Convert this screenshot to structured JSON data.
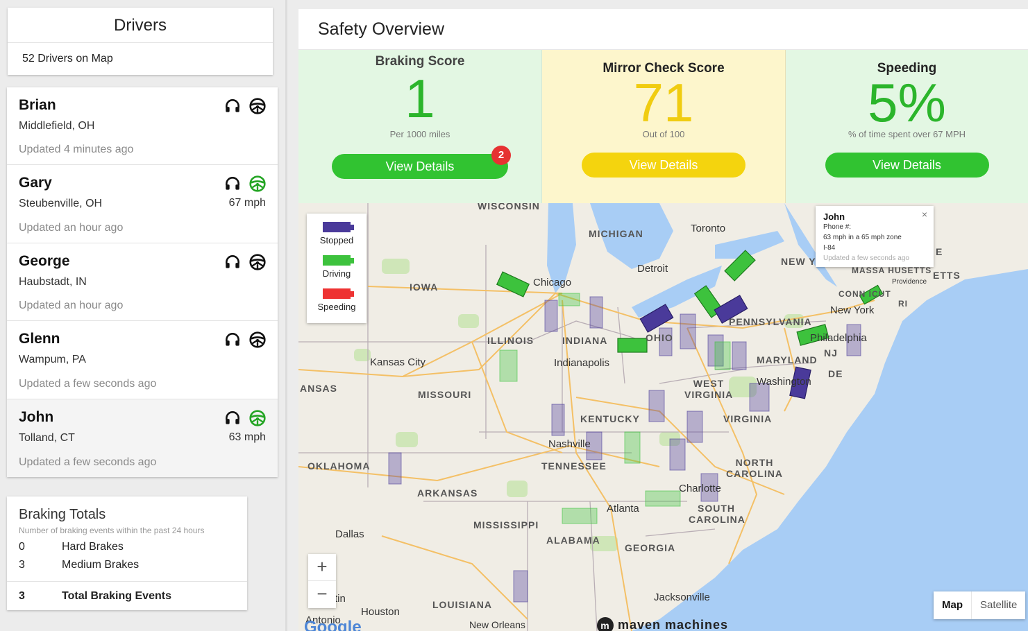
{
  "sidebar": {
    "title": "Drivers",
    "count_label": "52 Drivers on Map",
    "drivers": [
      {
        "name": "Brian",
        "location": "Middlefield, OH",
        "updated": "Updated 4 minutes ago",
        "speed": "",
        "status": "stopped"
      },
      {
        "name": "Gary",
        "location": "Steubenville, OH",
        "updated": "Updated an hour ago",
        "speed": "67 mph",
        "status": "driving"
      },
      {
        "name": "George",
        "location": "Haubstadt, IN",
        "updated": "Updated an hour ago",
        "speed": "",
        "status": "stopped"
      },
      {
        "name": "Glenn",
        "location": "Wampum, PA",
        "updated": "Updated a few seconds ago",
        "speed": "",
        "status": "stopped"
      },
      {
        "name": "John",
        "location": "Tolland, CT",
        "updated": "Updated a few seconds ago",
        "speed": "63 mph",
        "status": "driving"
      }
    ],
    "icons": {
      "call": "headset-icon",
      "wheel": "steering-wheel-icon"
    }
  },
  "braking_totals": {
    "title": "Braking Totals",
    "subtitle": "Number of braking events within the past 24 hours",
    "rows": [
      {
        "count": "0",
        "label": "Hard Brakes"
      },
      {
        "count": "3",
        "label": "Medium Brakes"
      }
    ],
    "total": {
      "count": "3",
      "label": "Total Braking Events"
    }
  },
  "main": {
    "title": "Safety Overview",
    "scores": [
      {
        "title": "Braking Score",
        "value": "1",
        "subtitle": "Per 1000 miles",
        "button": "View Details",
        "badge": "2",
        "color": "#2bb52b"
      },
      {
        "title": "Mirror Check Score",
        "value": "71",
        "subtitle": "Out of 100",
        "button": "View Details",
        "badge": "",
        "color": "#f0cc10"
      },
      {
        "title": "Speeding",
        "value": "5%",
        "subtitle": "% of time spent over 67 MPH",
        "button": "View Details",
        "badge": "",
        "color": "#2bb52b"
      }
    ]
  },
  "map": {
    "legend": [
      {
        "label": "Stopped",
        "color": "#4a3a9a"
      },
      {
        "label": "Driving",
        "color": "#3dc23d"
      },
      {
        "label": "Speeding",
        "color": "#ee3333"
      }
    ],
    "popup": {
      "name": "John",
      "phone": "Phone #:",
      "message": "63 mph in a 65 mph zone",
      "road": "I-84",
      "updated": "Updated a few seconds ago",
      "close": "×"
    },
    "zoom_in": "+",
    "zoom_out": "−",
    "map_type": {
      "map": "Map",
      "satellite": "Satellite"
    },
    "brand": "maven machines",
    "brand_mark": "m",
    "google": "Google",
    "state_labels": [
      "WISCONSIN",
      "MICHIGAN",
      "IOWA",
      "ILLINOIS",
      "INDIANA",
      "OHIO",
      "PENNSYLVANIA",
      "NEW Y",
      "MASSA HUSETTS",
      "CONN ICUT",
      "MISSOURI",
      "KENTUCKY",
      "WEST VIRGINIA",
      "VIRGINIA",
      "MARYLAND",
      "DE",
      "NJ",
      "TENNESSEE",
      "NORTH CAROLINA",
      "SOUTH CAROLINA",
      "ARKANSAS",
      "MISSISSIPPI",
      "ALABAMA",
      "GEORGIA",
      "LOUISIANA",
      "OKLAHOMA",
      "ANSAS",
      "RI",
      "ETTS",
      "E"
    ],
    "city_labels": [
      "Toronto",
      "Detroit",
      "Chicago",
      "Indianapolis",
      "Kansas City",
      "Nashville",
      "Charlotte",
      "Atlanta",
      "Dallas",
      "Houston",
      "Jacksonville",
      "New Orleans",
      "New York",
      "Philadelphia",
      "Washington",
      "Providence",
      "Antonio",
      "tin"
    ]
  }
}
